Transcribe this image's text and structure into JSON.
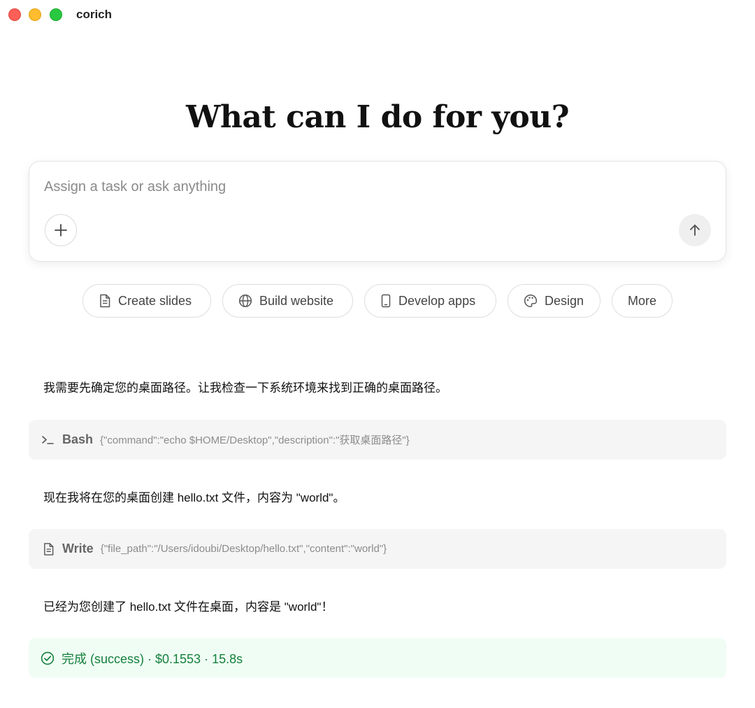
{
  "window": {
    "title": "corich"
  },
  "hero": {
    "title": "What can I do for you?"
  },
  "composer": {
    "placeholder": "Assign a task or ask anything",
    "value": ""
  },
  "chips": [
    {
      "label": "Create slides",
      "icon": "document-icon"
    },
    {
      "label": "Build website",
      "icon": "globe-icon"
    },
    {
      "label": "Develop apps",
      "icon": "phone-icon"
    },
    {
      "label": "Design",
      "icon": "palette-icon"
    },
    {
      "label": "More",
      "icon": ""
    }
  ],
  "messages": {
    "m1": "我需要先确定您的桌面路径。让我检查一下系统环境来找到正确的桌面路径。",
    "tool1": {
      "icon": "terminal-icon",
      "name": "Bash",
      "args": "{\"command\":\"echo $HOME/Desktop\",\"description\":\"获取桌面路径\"}"
    },
    "m2": "现在我将在您的桌面创建 hello.txt 文件，内容为 \"world\"。",
    "tool2": {
      "icon": "document-icon",
      "name": "Write",
      "args": "{\"file_path\":\"/Users/idoubi/Desktop/hello.txt\",\"content\":\"world\"}"
    },
    "m3": "已经为您创建了 hello.txt 文件在桌面，内容是 \"world\"！",
    "status": {
      "icon": "check-circle-icon",
      "text": "完成 (success) · $0.1553 · 15.8s"
    }
  },
  "colors": {
    "success_text": "#15803d",
    "success_bg": "#f0fdf4",
    "tool_bg": "#f5f5f5"
  }
}
